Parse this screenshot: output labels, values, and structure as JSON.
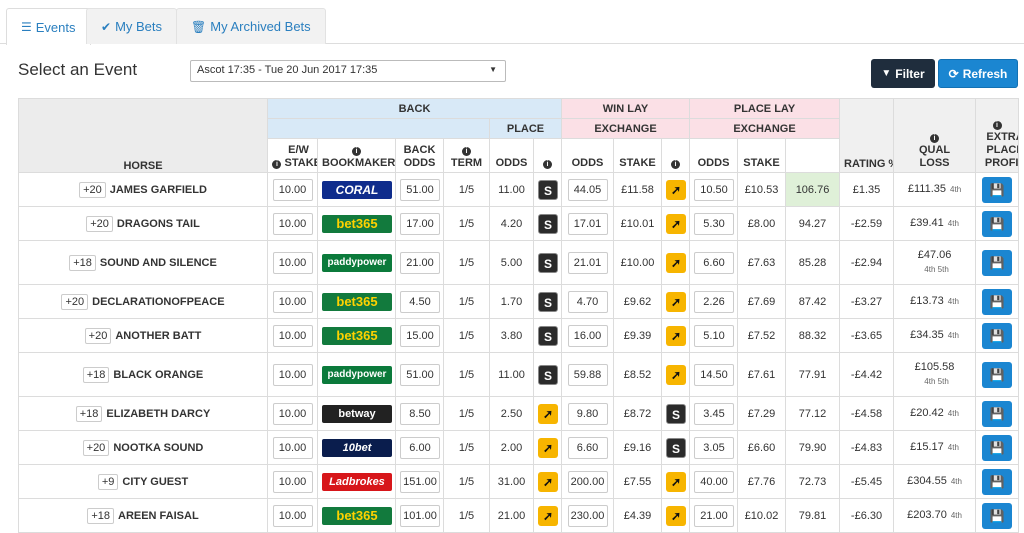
{
  "tabs": [
    {
      "label": "Events",
      "icon": "list-icon"
    },
    {
      "label": "My Bets",
      "icon": "check-icon"
    },
    {
      "label": "My Archived Bets",
      "icon": "trash-icon"
    }
  ],
  "header": {
    "title": "Select an Event",
    "event_select": "Ascot 17:35 - Tue 20 Jun 2017 17:35",
    "filter_label": "Filter",
    "refresh_label": "Refresh"
  },
  "columns": {
    "back": "BACK",
    "win_lay": "WIN LAY",
    "place_lay": "PLACE LAY",
    "place": "PLACE",
    "exchange": "EXCHANGE",
    "horse": "HORSE",
    "ew_stake": "E/W STAKE",
    "bookmaker": "BOOKMAKER",
    "back_odds": "BACK ODDS",
    "term": "TERM",
    "odds": "ODDS",
    "stake": "STAKE",
    "rating": "RATING %",
    "qual_loss": "QUAL LOSS",
    "extra_place_profit": "EXTRA PLACE PROFIT"
  },
  "rows": [
    {
      "num": "20",
      "horse": "JAMES GARFIELD",
      "stake": "10.00",
      "bookmaker": "CORAL",
      "bm": "coral",
      "back_odds": "51.00",
      "term": "1/5",
      "place_odds": "11.00",
      "win_ex": "s",
      "win_odds": "44.05",
      "win_stake": "£11.58",
      "place_ex": "y",
      "place_odds_lay": "10.50",
      "place_stake": "£10.53",
      "rating": "106.76",
      "qual_loss": "£1.35",
      "profit": "£111.35",
      "places": "4th"
    },
    {
      "num": "20",
      "horse": "DRAGONS TAIL",
      "stake": "10.00",
      "bookmaker": "bet365",
      "bm": "bet365",
      "back_odds": "17.00",
      "term": "1/5",
      "place_odds": "4.20",
      "win_ex": "s",
      "win_odds": "17.01",
      "win_stake": "£10.01",
      "place_ex": "y",
      "place_odds_lay": "5.30",
      "place_stake": "£8.00",
      "rating": "94.27",
      "qual_loss": "-£2.59",
      "profit": "£39.41",
      "places": "4th"
    },
    {
      "num": "18",
      "horse": "SOUND AND SILENCE",
      "stake": "10.00",
      "bookmaker": "paddypower",
      "bm": "paddy",
      "back_odds": "21.00",
      "term": "1/5",
      "place_odds": "5.00",
      "win_ex": "s",
      "win_odds": "21.01",
      "win_stake": "£10.00",
      "place_ex": "y",
      "place_odds_lay": "6.60",
      "place_stake": "£7.63",
      "rating": "85.28",
      "qual_loss": "-£2.94",
      "profit": "£47.06",
      "places": "4th 5th"
    },
    {
      "num": "20",
      "horse": "DECLARATIONOFPEACE",
      "stake": "10.00",
      "bookmaker": "bet365",
      "bm": "bet365",
      "back_odds": "4.50",
      "term": "1/5",
      "place_odds": "1.70",
      "win_ex": "s",
      "win_odds": "4.70",
      "win_stake": "£9.62",
      "place_ex": "y",
      "place_odds_lay": "2.26",
      "place_stake": "£7.69",
      "rating": "87.42",
      "qual_loss": "-£3.27",
      "profit": "£13.73",
      "places": "4th"
    },
    {
      "num": "20",
      "horse": "ANOTHER BATT",
      "stake": "10.00",
      "bookmaker": "bet365",
      "bm": "bet365",
      "back_odds": "15.00",
      "term": "1/5",
      "place_odds": "3.80",
      "win_ex": "s",
      "win_odds": "16.00",
      "win_stake": "£9.39",
      "place_ex": "y",
      "place_odds_lay": "5.10",
      "place_stake": "£7.52",
      "rating": "88.32",
      "qual_loss": "-£3.65",
      "profit": "£34.35",
      "places": "4th"
    },
    {
      "num": "18",
      "horse": "BLACK ORANGE",
      "stake": "10.00",
      "bookmaker": "paddypower",
      "bm": "paddy",
      "back_odds": "51.00",
      "term": "1/5",
      "place_odds": "11.00",
      "win_ex": "s",
      "win_odds": "59.88",
      "win_stake": "£8.52",
      "place_ex": "y",
      "place_odds_lay": "14.50",
      "place_stake": "£7.61",
      "rating": "77.91",
      "qual_loss": "-£4.42",
      "profit": "£105.58",
      "places": "4th 5th"
    },
    {
      "num": "18",
      "horse": "ELIZABETH DARCY",
      "stake": "10.00",
      "bookmaker": "betway",
      "bm": "betway",
      "back_odds": "8.50",
      "term": "1/5",
      "place_odds": "2.50",
      "win_ex": "y",
      "win_odds": "9.80",
      "win_stake": "£8.72",
      "place_ex": "s",
      "place_odds_lay": "3.45",
      "place_stake": "£7.29",
      "rating": "77.12",
      "qual_loss": "-£4.58",
      "profit": "£20.42",
      "places": "4th"
    },
    {
      "num": "20",
      "horse": "NOOTKA SOUND",
      "stake": "10.00",
      "bookmaker": "10bet",
      "bm": "10bet",
      "back_odds": "6.00",
      "term": "1/5",
      "place_odds": "2.00",
      "win_ex": "y",
      "win_odds": "6.60",
      "win_stake": "£9.16",
      "place_ex": "s",
      "place_odds_lay": "3.05",
      "place_stake": "£6.60",
      "rating": "79.90",
      "qual_loss": "-£4.83",
      "profit": "£15.17",
      "places": "4th"
    },
    {
      "num": "9",
      "horse": "CITY GUEST",
      "stake": "10.00",
      "bookmaker": "Ladbrokes",
      "bm": "lad",
      "back_odds": "151.00",
      "term": "1/5",
      "place_odds": "31.00",
      "win_ex": "y",
      "win_odds": "200.00",
      "win_stake": "£7.55",
      "place_ex": "y",
      "place_odds_lay": "40.00",
      "place_stake": "£7.76",
      "rating": "72.73",
      "qual_loss": "-£5.45",
      "profit": "£304.55",
      "places": "4th"
    },
    {
      "num": "18",
      "horse": "AREEN FAISAL",
      "stake": "10.00",
      "bookmaker": "bet365",
      "bm": "bet365",
      "back_odds": "101.00",
      "term": "1/5",
      "place_odds": "21.00",
      "win_ex": "y",
      "win_odds": "230.00",
      "win_stake": "£4.39",
      "place_ex": "y",
      "place_odds_lay": "21.00",
      "place_stake": "£10.02",
      "rating": "79.81",
      "qual_loss": "-£6.30",
      "profit": "£203.70",
      "places": "4th"
    }
  ],
  "colors": {
    "accent": "#1b86d1",
    "back_header": "#d8e9f7",
    "lay_header": "#fbe0e6",
    "highlight": "#dff0d8"
  }
}
